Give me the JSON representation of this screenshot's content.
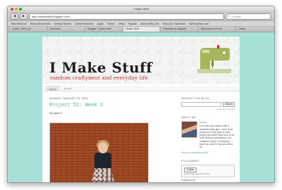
{
  "window": {
    "title": "I Make Stuff"
  },
  "nav": {
    "back": "◀",
    "forward": "▶",
    "url": "http://imakestuff.blogspot.com/",
    "search_placeholder": "Google"
  },
  "bookmarks": [
    "Mac Webmail",
    "Select Bookmarks",
    "Getting Started",
    "Latest Headlines",
    "Apple",
    "Yahoo!",
    "News",
    "Popular",
    "Add to Wish List",
    "About Us: Facebook",
    "MyShopAttic.com"
  ],
  "tabs": [
    "Gmail - Inbox (3)",
    "Facebook",
    "Blogger: I Make Stuff",
    "I Make Stuff",
    "Followers to Support",
    "Welcome to Picnik",
    "Crafty"
  ],
  "blog": {
    "title": "I Make Stuff",
    "description": "random craftyness and everyday life",
    "nav_tabs": [
      "Home",
      "About"
    ]
  },
  "post": {
    "date": "SUNDAY, JANUARY 23, 2011",
    "title": "Project 52: Week 3",
    "body": "My week 3:"
  },
  "sidebar": {
    "search_heading": "SEARCH THIS BLOG",
    "search_button": "Search",
    "powered_by": "powered by Google",
    "about_heading": "ABOUT ME",
    "about_name": "Marisa",
    "about_text": "I'm a wife and mother with 2 wonderful little girls. I love to do pretty much any type of craft project but never have time to do it all. Without something to do mindless hobby, I'd probably have my mind to my own with a lot.",
    "profile_link": "View my complete profile",
    "followers_heading": "FOLLOWERS",
    "follow_button": "Follow",
    "gfc_text": "with Google Friend Connect",
    "followers_count": "Followers (9)"
  },
  "colors": {
    "background": "#a7e0d7",
    "title_red": "#c7353b",
    "accent_teal": "#59b0a8",
    "machine_green": "#a6b65a"
  }
}
